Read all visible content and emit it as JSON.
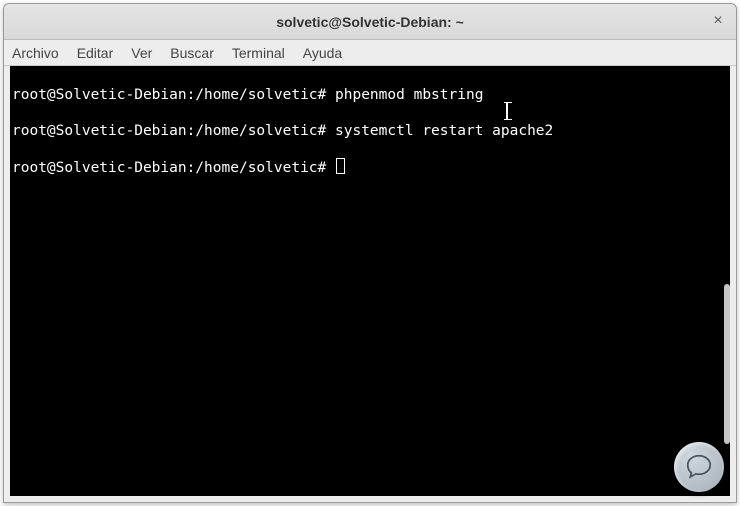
{
  "window": {
    "title": "solvetic@Solvetic-Debian: ~",
    "close_glyph": "×"
  },
  "menu": {
    "items": [
      "Archivo",
      "Editar",
      "Ver",
      "Buscar",
      "Terminal",
      "Ayuda"
    ]
  },
  "terminal": {
    "prompt": "root@Solvetic-Debian:/home/solvetic#",
    "lines": [
      {
        "prompt": "root@Solvetic-Debian:/home/solvetic#",
        "cmd": "phpenmod mbstring"
      },
      {
        "prompt": "root@Solvetic-Debian:/home/solvetic#",
        "cmd": "systemctl restart apache2"
      },
      {
        "prompt": "root@Solvetic-Debian:/home/solvetic#",
        "cmd": ""
      }
    ]
  }
}
